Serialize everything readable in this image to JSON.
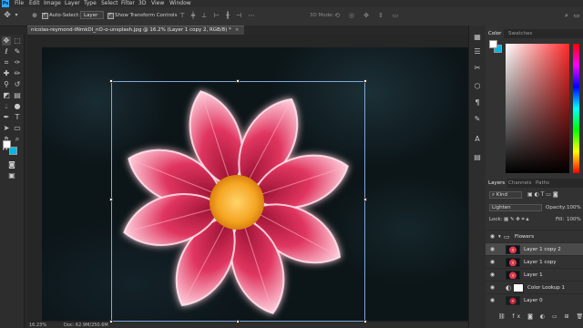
{
  "menubar": {
    "logo": "Ps",
    "items": [
      "File",
      "Edit",
      "Image",
      "Layer",
      "Type",
      "Select",
      "Filter",
      "3D",
      "View",
      "Window"
    ]
  },
  "options": {
    "auto_select_label": "Auto-Select:",
    "auto_select_target": "Layer",
    "show_transform_label": "Show Transform Controls",
    "mode_3d_label": "3D Mode:"
  },
  "document": {
    "tab_title": "nicolas-reymond-tNmkDI_nO-o-unsplash.jpg @ 16.2% (Layer 1 copy 2, RGB/8) *",
    "tab_close": "×"
  },
  "status": {
    "zoom": "16.23%",
    "doc_info": "Doc: 62.9M/250.6M"
  },
  "color_panel": {
    "tabs": [
      "Color",
      "Swatches"
    ],
    "foreground_color": "#ffffff",
    "background_color": "#00b7e6"
  },
  "layers_panel": {
    "tabs": [
      "Layers",
      "Channels",
      "Paths"
    ],
    "filter_label": "Kind",
    "blend_mode": "Lighten",
    "opacity_label": "Opacity:",
    "opacity_value": "100%",
    "lock_label": "Lock:",
    "fill_label": "Fill:",
    "fill_value": "100%",
    "layers": [
      {
        "name": "Flowers",
        "type": "group",
        "visible": true,
        "selected": false
      },
      {
        "name": "Layer 1 copy 2",
        "type": "pixel",
        "visible": true,
        "selected": true
      },
      {
        "name": "Layer 1 copy",
        "type": "pixel",
        "visible": true,
        "selected": false
      },
      {
        "name": "Layer 1",
        "type": "pixel",
        "visible": true,
        "selected": false
      },
      {
        "name": "Color Lookup 1",
        "type": "adjustment",
        "visible": true,
        "selected": false
      },
      {
        "name": "Layer 0",
        "type": "pixel",
        "visible": true,
        "selected": false
      }
    ]
  },
  "colors": {
    "accent": "#31a8ff",
    "petal": "#e0355f",
    "flower_center": "#f5a623"
  },
  "icons": {
    "tools": [
      "move-icon",
      "marquee-icon",
      "lasso-icon",
      "quick-select-icon",
      "crop-icon",
      "eyedropper-icon",
      "healing-icon",
      "brush-icon",
      "stamp-icon",
      "history-brush-icon",
      "eraser-icon",
      "gradient-icon",
      "blur-icon",
      "dodge-icon",
      "pen-icon",
      "type-icon",
      "path-select-icon",
      "shape-icon",
      "hand-icon",
      "zoom-icon"
    ],
    "right_column": [
      "history-icon",
      "properties-icon",
      "adjustments-icon",
      "3d-icon",
      "paragraph-icon",
      "character-icon",
      "glyphs-icon",
      "libraries-icon"
    ]
  }
}
